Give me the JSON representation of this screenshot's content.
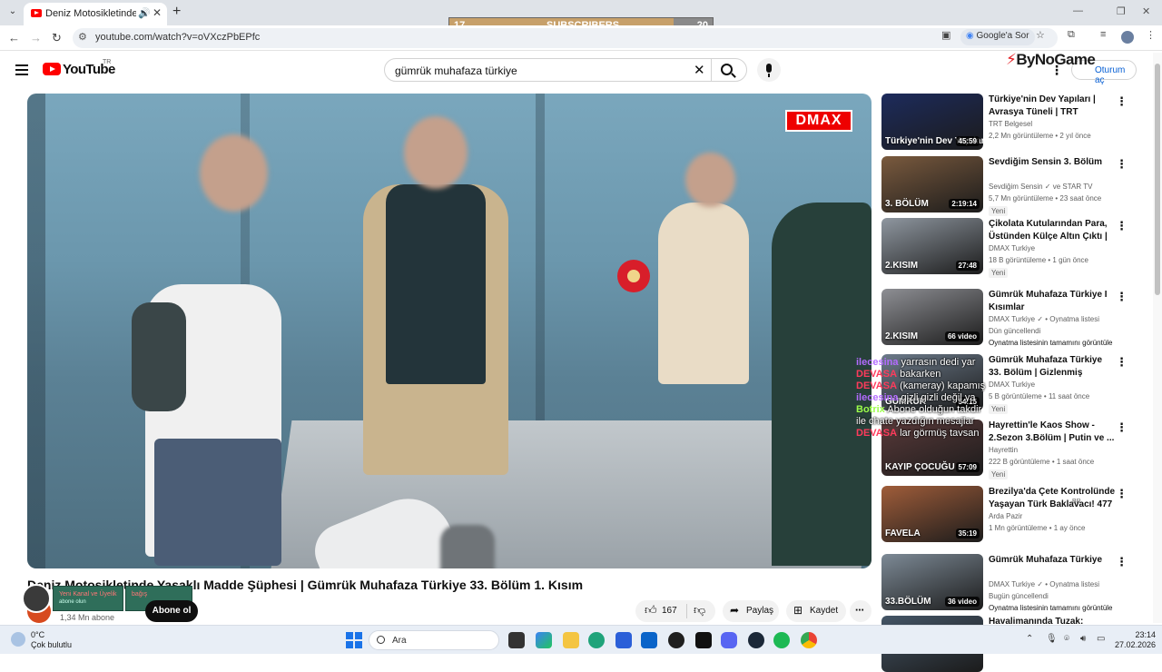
{
  "browser": {
    "tab_title": "Deniz Motosikletinde Yasakl",
    "url": "youtube.com/watch?v=oVXczPbEPfc",
    "google_sor_label": "Google'a Sor"
  },
  "subscriber_goal": {
    "label": "SUBSCRIBERS",
    "current": "17",
    "goal": "20",
    "progress": 0.85
  },
  "youtube": {
    "logo_text": "YouTube",
    "country_code": "TR",
    "search_query": "gümrük muhafaza türkiye",
    "signin_label": "Oturum aç",
    "overlay_brand": "ByNoGame"
  },
  "video": {
    "title": "Deniz Motosikletinde Yasaklı Madde Şüphesi | Gümrük Muhafaza Türkiye 33. Bölüm 1. Kısım",
    "watermark": "DMAX",
    "subscribers": "1,34 Mn abone",
    "subscribe_label": "Abone ol",
    "likes": "167",
    "share_label": "Paylaş",
    "save_label": "Kaydet"
  },
  "recommendations": [
    {
      "title": "Türkiye'nin Dev Yapıları | Avrasya Tüneli | TRT Belgesel",
      "channel": "TRT Belgesel",
      "meta": "2,2 Mn görüntüleme • 2 yıl önce",
      "duration": "45:59",
      "thumb_text": "Türkiye'nin Dev Yapıları",
      "badge": "",
      "thumb_color": "#1d2b5c"
    },
    {
      "title": "Sevdiğim Sensin 3. Bölüm",
      "channel": "Sevdiğim Sensin ✓ ve STAR TV",
      "meta": "5,7 Mn görüntüleme • 23 saat önce",
      "duration": "2:19:14",
      "thumb_text": "3. BÖLÜM",
      "badge": "Yeni",
      "thumb_color": "#7a5a3e"
    },
    {
      "title": "Çikolata Kutularından Para, Üstünden Külçe Altın Çıktı | ...",
      "channel": "DMAX Turkiye",
      "meta": "18 B görüntüleme • 1 gün önce",
      "duration": "27:48",
      "thumb_text": "2.KISIM",
      "badge": "Yeni",
      "thumb_color": "#8f97a0"
    },
    {
      "title": "Gümrük Muhafaza Türkiye I Kısımlar",
      "channel": "DMAX Turkiye ✓ • Oynatma listesi",
      "meta": "Dün güncellendi",
      "duration": "66 video",
      "thumb_text": "2.KISIM",
      "badge": "",
      "extra": "Oynatma listesinin tamamını görüntüle",
      "thumb_color": "#8e8f94"
    },
    {
      "title": "Gümrük Muhafaza Türkiye 33. Bölüm | Gizlenmiş Paralar, Kül...",
      "channel": "DMAX Turkiye",
      "meta": "5 B görüntüleme • 11 saat önce",
      "duration": "54:15",
      "thumb_text": "GÜMRÜK",
      "badge": "Yeni",
      "thumb_color": "#6c7a8a"
    },
    {
      "title": "Hayrettin'le Kaos Show - 2.Sezon 3.Bölüm | Putin ve ...",
      "channel": "Hayrettin",
      "meta": "222 B görüntüleme • 1 saat önce",
      "duration": "57:09",
      "thumb_text": "KAYIP ÇOCUĞU",
      "badge": "Yeni",
      "thumb_color": "#5a3a3a"
    },
    {
      "title": "Brezilya'da Çete Kontrolünde Yaşayan Türk Baklavacı! 477",
      "channel": "Arda Pazir",
      "meta": "1 Mn görüntüleme • 1 ay önce",
      "duration": "35:19",
      "thumb_text": "FAVELA",
      "badge": "",
      "title_suffix": "BR",
      "thumb_color": "#a05d3a"
    },
    {
      "title": "Gümrük Muhafaza Türkiye",
      "channel": "DMAX Turkiye ✓ • Oynatma listesi",
      "meta": "Bugün güncellendi",
      "duration": "36 video",
      "thumb_text": "33.BÖLÜM",
      "badge": "",
      "extra": "Oynatma listesinin tamamını görüntüle",
      "thumb_color": "#7d8a96"
    },
    {
      "title": "Havalimanında Tuzak: Hediyelik",
      "channel": "",
      "meta": "",
      "duration": "",
      "thumb_text": "",
      "badge": "",
      "thumb_color": "#445566"
    }
  ],
  "chat": [
    {
      "name": "ilecesina",
      "message": "yarrasın dedi yar",
      "color": "#b36bff"
    },
    {
      "name": "DEVASA",
      "message": "bakarken",
      "color": "#ff3b5c"
    },
    {
      "name": "DEVASA",
      "message": "(kameray) kapamış",
      "color": "#ff3b5c"
    },
    {
      "name": "ilecesina",
      "message": "gizli gizli değil ya",
      "color": "#b36bff"
    },
    {
      "name": "Botrix",
      "message": "Abone olduğun takdir",
      "color": "#9cff4a"
    },
    {
      "name": "",
      "message": "ile chate yazdığın mesajlar",
      "color": "#ffffff"
    },
    {
      "name": "DEVASA",
      "message": "lar görmüş tavsan",
      "color": "#ff3b5c"
    }
  ],
  "overlay_card": {
    "line1": "Yeni Kanal ve Üyelik",
    "line2": "abone olun"
  },
  "overlay_card2": {
    "line1": "bağış",
    "line2": ""
  },
  "taskbar": {
    "temperature": "0°C",
    "weather": "Çok bulutlu",
    "search_placeholder": "Ara",
    "time": "23:14",
    "date": "27.02.2026"
  }
}
